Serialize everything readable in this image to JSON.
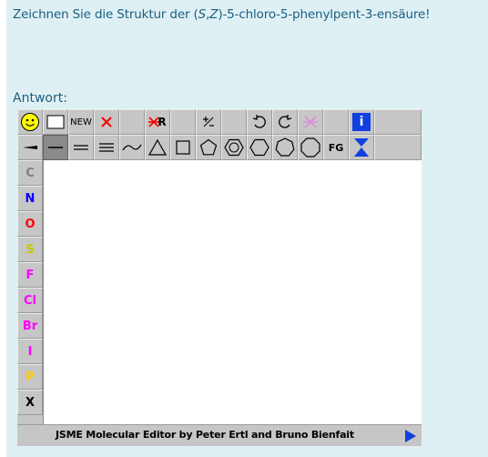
{
  "question": {
    "prefix": "Zeichnen Sie die Struktur der (",
    "stereo_s": "S",
    "comma": ",",
    "stereo_z": "Z",
    "suffix": ")-5-chloro-5-phenylpent-3-ensäure!"
  },
  "answer_label": "Antwort:",
  "toolbar": {
    "new_label": "NEW",
    "remove_r_label": "R",
    "charge_label": "+/-",
    "fg_label": "FG",
    "info_label": "i"
  },
  "elements": [
    {
      "symbol": "C",
      "color": "#808080"
    },
    {
      "symbol": "N",
      "color": "#0000ff"
    },
    {
      "symbol": "O",
      "color": "#ff0000"
    },
    {
      "symbol": "S",
      "color": "#c8c800"
    },
    {
      "symbol": "F",
      "color": "#ff00ff"
    },
    {
      "symbol": "Cl",
      "color": "#ff00ff"
    },
    {
      "symbol": "Br",
      "color": "#ff00ff"
    },
    {
      "symbol": "I",
      "color": "#ff00ff"
    },
    {
      "symbol": "P",
      "color": "#ffc800"
    },
    {
      "symbol": "X",
      "color": "#000000"
    }
  ],
  "status": {
    "text": "JSME Molecular Editor by Peter Ertl and Bruno Bienfait"
  },
  "colors": {
    "panel_bg": "#dff0f5",
    "question_text": "#1b5e80",
    "toolbar_bg": "#c6c6c6",
    "accent_blue": "#1040e0",
    "delete_red": "#ff0000"
  }
}
